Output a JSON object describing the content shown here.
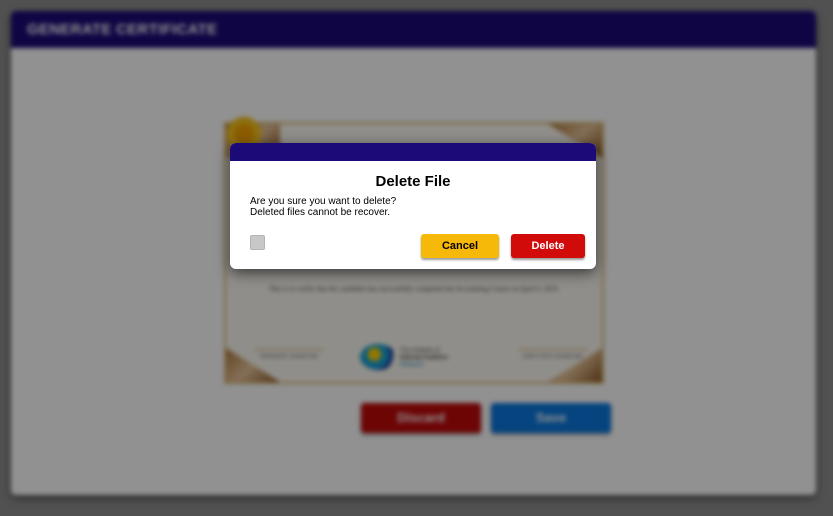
{
  "header": {
    "title": "GENERATE CERTIFICATE"
  },
  "certificate": {
    "body_text": "This is to certify that the candidate has successfully completed the Accounting Course on April 6, 2019.",
    "signature_left": "PRESIDENT SIGNATURE",
    "signature_right": "DIRECTOR'S SIGNATURE",
    "org_line1": "The Institute of",
    "org_line2": "Internal Auditors",
    "org_line3": "Malaysia"
  },
  "actions": {
    "discard_label": "Discard",
    "save_label": "Save"
  },
  "dialog": {
    "title": "Delete File",
    "message_line1": "Are you sure you want to delete?",
    "message_line2": "Deleted files cannot be recover.",
    "cancel_label": "Cancel",
    "delete_label": "Delete"
  },
  "colors": {
    "header": "#1c0a78",
    "cancel": "#f6b90a",
    "delete": "#d10a0a",
    "save": "#0a78e0"
  }
}
